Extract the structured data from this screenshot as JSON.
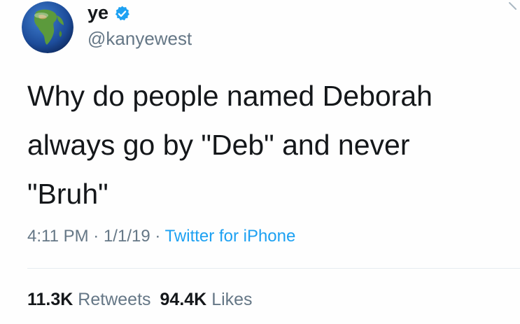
{
  "user": {
    "display_name": "ye",
    "handle": "@kanyewest",
    "verified": true
  },
  "tweet": {
    "text": "Why do people named Deborah\nalways go by \"Deb\" and never\n\"Bruh\"",
    "time": "4:11 PM",
    "separator": "·",
    "date": "1/1/19",
    "source": "Twitter for iPhone"
  },
  "stats": {
    "retweets_count": "11.3K",
    "retweets_label": "Retweets",
    "likes_count": "94.4K",
    "likes_label": "Likes"
  },
  "icons": {
    "avatar": "globe-avatar",
    "verified": "verified-badge-icon"
  },
  "colors": {
    "text": "#14171a",
    "secondary": "#657786",
    "link": "#1da1f2",
    "verified": "#1da1f2"
  }
}
